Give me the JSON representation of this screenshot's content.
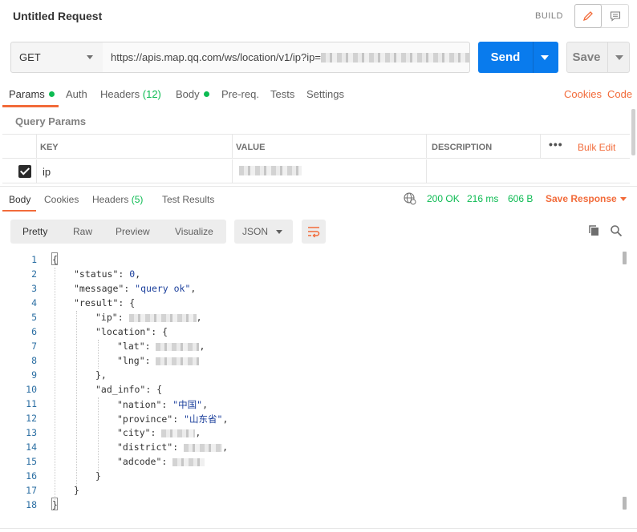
{
  "window": {
    "title": "Untitled Request",
    "mode_label": "BUILD"
  },
  "request": {
    "method": "GET",
    "url": "https://apis.map.qq.com/ws/location/v1/ip?ip=",
    "send_label": "Send",
    "save_label": "Save"
  },
  "request_tabs": {
    "params": "Params",
    "auth": "Auth",
    "headers": "Headers",
    "headers_count": "(12)",
    "body": "Body",
    "prereq": "Pre-req.",
    "tests": "Tests",
    "settings": "Settings",
    "cookies_link": "Cookies",
    "code_link": "Code"
  },
  "query_params": {
    "title": "Query Params",
    "headers": {
      "key": "KEY",
      "value": "VALUE",
      "description": "DESCRIPTION"
    },
    "more": "•••",
    "bulk_edit": "Bulk Edit",
    "rows": [
      {
        "checked": true,
        "key": "ip",
        "value": ""
      }
    ]
  },
  "response_tabs": {
    "body": "Body",
    "cookies": "Cookies",
    "headers": "Headers",
    "headers_count": "(5)",
    "test_results": "Test Results",
    "status": "200 OK",
    "time": "216 ms",
    "size": "606 B",
    "save_response": "Save Response"
  },
  "format_bar": {
    "pretty": "Pretty",
    "raw": "Raw",
    "preview": "Preview",
    "visualize": "Visualize",
    "language": "JSON"
  },
  "code_lines": {
    "l1": "{",
    "l2_key": "\"status\"",
    "l2_val": "0",
    "l3_key": "\"message\"",
    "l3_val": "\"query ok\"",
    "l4_key": "\"result\"",
    "l5_key": "\"ip\"",
    "l6_key": "\"location\"",
    "l7_key": "\"lat\"",
    "l8_key": "\"lng\"",
    "l9": "},",
    "l10_key": "\"ad_info\"",
    "l11_key": "\"nation\"",
    "l11_val": "\"中国\"",
    "l12_key": "\"province\"",
    "l12_val": "\"山东省\"",
    "l13_key": "\"city\"",
    "l14_key": "\"district\"",
    "l15_key": "\"adcode\"",
    "l16": "}",
    "l17": "}",
    "l18": "}"
  }
}
